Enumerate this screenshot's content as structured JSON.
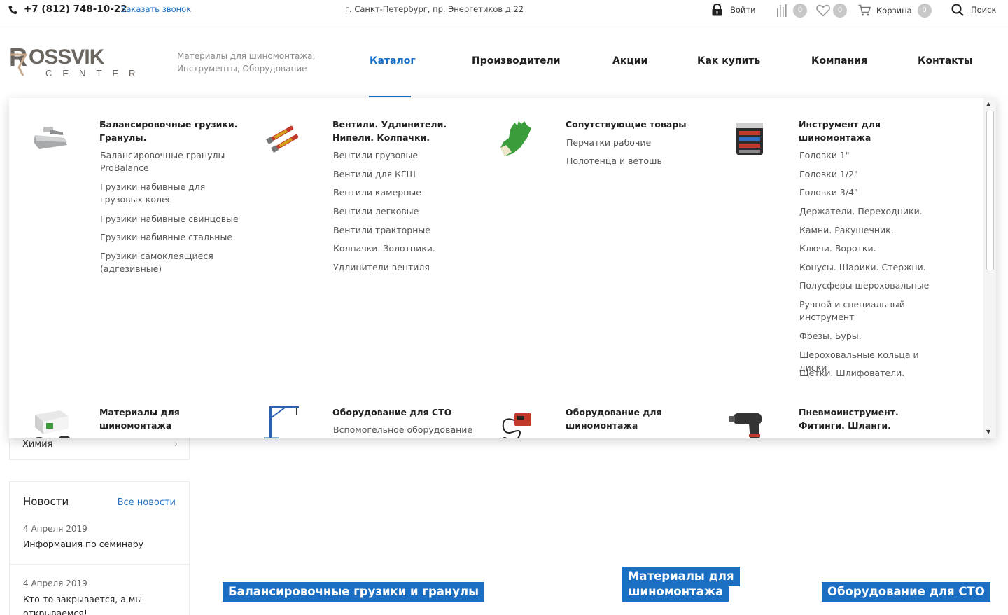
{
  "topbar": {
    "phone": "+7 (812) 748-10-22",
    "callback": "Заказать звонок",
    "address": "г. Санкт-Петербург, пр. Энергетиков д.22",
    "login": "Войти",
    "compare_count": "0",
    "favorites_count": "0",
    "cart_label": "Корзина",
    "cart_count": "0",
    "search_label": "Поиск"
  },
  "header": {
    "logo_text": "ROSSVIK",
    "logo_sub": "CENTER",
    "tagline": "Материалы для шиномонтажа, Инструменты, Оборудование",
    "nav": [
      "Каталог",
      "Производители",
      "Акции",
      "Как купить",
      "Компания",
      "Контакты"
    ]
  },
  "mega_menu": {
    "columns": [
      {
        "title": "Балансировочные грузики. Гранулы.",
        "icon": "wheel-weight-icon",
        "links": [
          "Балансировочные гранулы ProBalance",
          "Грузики набивные для грузовых колес",
          "Грузики набивные свинцовые",
          "Грузики набивные стальные",
          "Грузики самоклеящиеся (адгезивные)"
        ]
      },
      {
        "title": "Вентили. Удлинители. Нипели. Колпачки.",
        "icon": "valve-icon",
        "links": [
          "Вентили грузовые",
          "Вентили для КГШ",
          "Вентили камерные",
          "Вентили легковые",
          "Вентили тракторные",
          "Колпачки. Золотники.",
          "Удлинители вентиля"
        ]
      },
      {
        "title": "Сопутствующие товары",
        "icon": "glove-icon",
        "links": [
          "Перчатки рабочие",
          "Полотенца и ветошь"
        ]
      },
      {
        "title": "Инструмент для шиномонтажа",
        "icon": "toolbox-icon",
        "links": [
          "Головки 1\"",
          "Головки 1/2\"",
          "Головки 3/4\"",
          "Держатели. Переходники.",
          "Камни. Ракушечник.",
          "Ключи. Воротки.",
          "Конусы. Шарики. Стержни.",
          "Полусферы шероховальные",
          "Ручной и специальный инструмент",
          "Фрезы. Буры.",
          "Шероховальные кольца и диски",
          "Щетки. Шлифователи."
        ]
      }
    ],
    "row2": [
      {
        "title": "Материалы для шиномонтажа",
        "icon": "patch-kit-icon",
        "links": []
      },
      {
        "title": "Оборудование для СТО",
        "icon": "crane-icon",
        "links": [
          "Вспомогельное оборудование"
        ]
      },
      {
        "title": "Оборудование для шиномонтажа",
        "icon": "tester-icon",
        "links": []
      },
      {
        "title": "Пневмоинструмент. Фитинги. Шланги.",
        "icon": "impact-wrench-icon",
        "links": []
      }
    ]
  },
  "sidebar": {
    "item": "Химия"
  },
  "news": {
    "title": "Новости",
    "all_link": "Все новости",
    "items": [
      {
        "date": "4 Апреля 2019",
        "text": "Информация по семинару"
      },
      {
        "date": "4 Апреля 2019",
        "text": "Кто-то закрывается, а мы"
      },
      {
        "text_cut": "открываемся!"
      }
    ]
  },
  "banners": [
    "Балансировочные грузики и гранулы",
    "Материалы для",
    "шиномонтажа",
    "Оборудование для СТО"
  ],
  "colors": {
    "accent": "#1a6fc4",
    "text": "#222222",
    "muted": "#8a8a8a",
    "logo": "#6b6560",
    "badge": "#c7c7c7"
  }
}
